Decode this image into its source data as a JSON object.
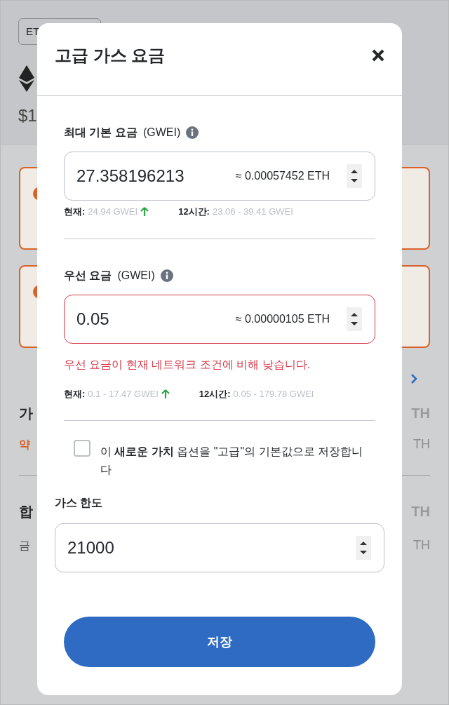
{
  "background": {
    "network_button": "ET",
    "balance": "$1",
    "rows": [
      {
        "kind": "heading",
        "label": "가",
        "value": "TH"
      },
      {
        "kind": "estimate",
        "label": "약",
        "value": "TH"
      },
      {
        "kind": "heading",
        "label": "합",
        "value": "TH"
      },
      {
        "kind": "note",
        "label": "금",
        "value": "TH"
      }
    ]
  },
  "modal": {
    "title": "고급 가스 요금",
    "fields": [
      {
        "label": "최대 기본 요금",
        "unit": "(GWEI)",
        "info": true,
        "value": "27.358196213",
        "approx": "≈ 0.00057452 ETH",
        "invalid": false,
        "hints": [
          {
            "label": "현재:",
            "value": "24.94 GWEI",
            "rising": true
          },
          {
            "label": "12시간:",
            "value": "23.06 - 39.41 GWEI"
          }
        ]
      },
      {
        "label": "우선 요금",
        "unit": "(GWEI)",
        "info": true,
        "value": "0.05",
        "approx": "≈ 0.00000105 ETH",
        "invalid": true,
        "error": "우선 요금이 현재 네트워크 조건에 비해 낮습니다.",
        "hints": [
          {
            "label": "현재:",
            "value": "0.1 - 17.47 GWEI",
            "rising": true
          },
          {
            "label": "12시간:",
            "value": "0.05 - 179.78 GWEI"
          }
        ]
      }
    ],
    "checkbox": {
      "checked": false,
      "label": "이 **새로운 가치** 옵션을 \"고급\"의 기본값으로 저장합니다"
    },
    "gas_limit": {
      "label": "가스 한도",
      "value": "21000"
    },
    "save_button": "저장"
  }
}
